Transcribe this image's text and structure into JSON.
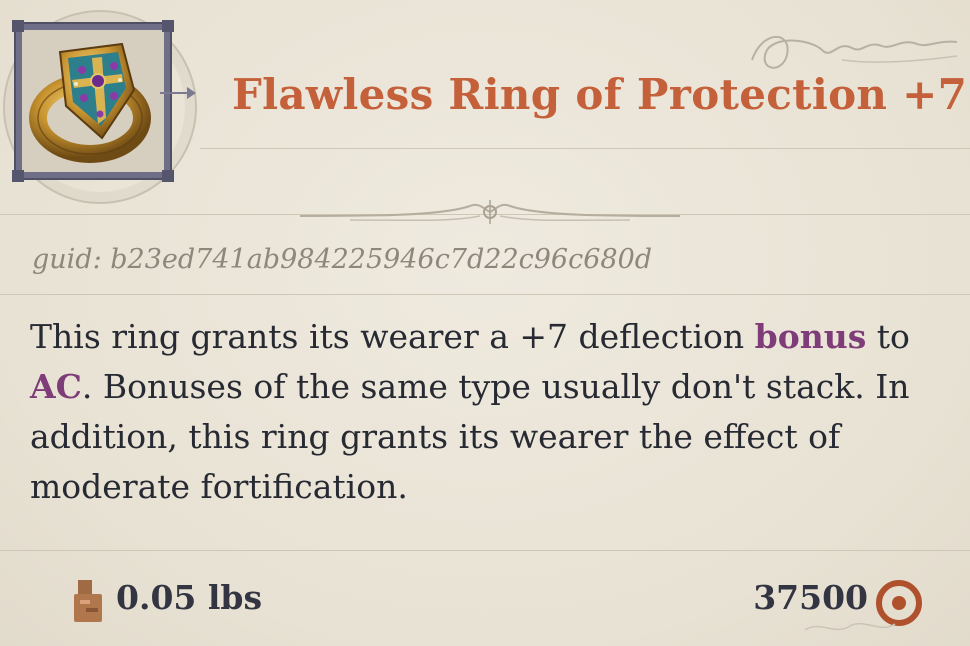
{
  "item": {
    "title": "Flawless Ring of Protection +7",
    "guid_text": "guid: b23ed741ab984225946c7d22c96c680d",
    "description": {
      "part1": "This ring grants its wearer a +7 deflection ",
      "kw1": "bonus",
      "part2": " to ",
      "kw2": "AC",
      "part3": ". Bonuses of the same type usually don't stack. In addition, this ring grants its wearer the effect of moderate fortification."
    },
    "weight": "0.05 lbs",
    "price": "37500"
  },
  "icons": {
    "portrait": "ring-of-protection-portrait",
    "weight": "weight-icon",
    "currency": "coin-icon"
  },
  "colors": {
    "title": "#c4603a",
    "keyword": "#7e3c78",
    "body_text": "#272a33",
    "guid_text": "#8d877c",
    "background": "#ebe5d8",
    "frame": "#6e6e86",
    "coin": "#b0512e"
  }
}
